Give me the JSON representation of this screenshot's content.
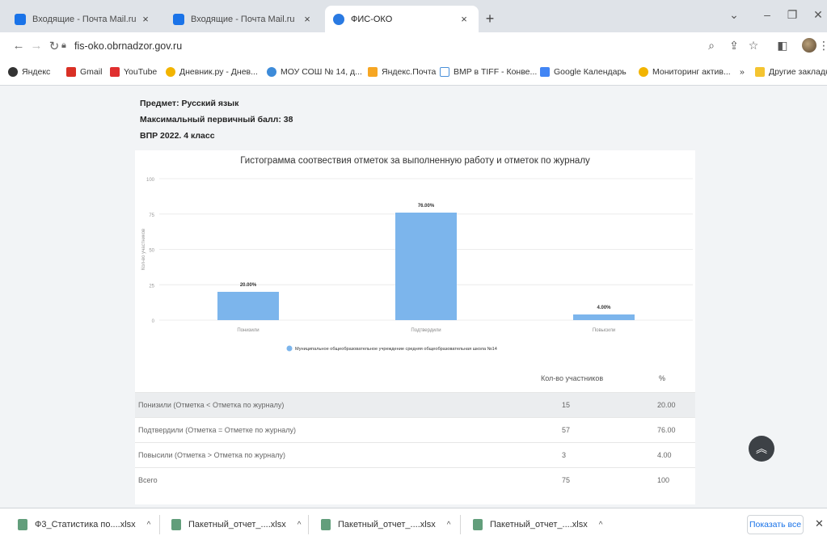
{
  "tabs": [
    {
      "title": "Входящие - Почта Mail.ru"
    },
    {
      "title": "Входящие - Почта Mail.ru"
    },
    {
      "title": "ФИС-ОКО"
    }
  ],
  "address": "fis-oko.obrnadzor.gov.ru",
  "bookmarks": [
    "Яндекс",
    "Gmail",
    "YouTube",
    "Дневник.ру - Днев...",
    "МОУ СОШ № 14, д...",
    "Яндекс.Почта",
    "BMP в TIFF - Конве...",
    "Google Календарь",
    "Мониторинг актив...",
    "»",
    "Другие закладки"
  ],
  "info": {
    "subject": "Предмет: Русский язык",
    "max_score": "Максимальный первичный балл: 38",
    "exam": "ВПР 2022. 4 класс"
  },
  "chart_data": {
    "type": "bar",
    "title": "Гистограмма соотвествия отметок за выполненную работу и отметок по журналу",
    "ylabel": "Кол-во участников",
    "categories": [
      "Понизили",
      "Подтвердили",
      "Повысили"
    ],
    "series": [
      {
        "name": "Муниципальное общеобразовательное учреждение средняя общеобразовательная школа №14",
        "values": [
          20,
          76,
          4
        ],
        "labels": [
          "20.00%",
          "76.00%",
          "4.00%"
        ],
        "color": "#7cb5ec"
      }
    ],
    "yticks": [
      "0",
      "25",
      "50",
      "75",
      "100"
    ],
    "ylim": [
      0,
      100
    ]
  },
  "table": {
    "headers": [
      "Кол-во участников",
      "%"
    ],
    "rows": [
      {
        "label": "Понизили (Отметка < Отметка по журналу)",
        "count": "15",
        "pct": "20.00"
      },
      {
        "label": "Подтвердили (Отметка = Отметке по журналу)",
        "count": "57",
        "pct": "76.00"
      },
      {
        "label": "Повысили (Отметка > Отметка по журналу)",
        "count": "3",
        "pct": "4.00"
      },
      {
        "label": "Всего",
        "count": "75",
        "pct": "100"
      }
    ]
  },
  "downloads": {
    "items": [
      "Ф3_Статистика по....xlsx",
      "Пакетный_отчет_....xlsx",
      "Пакетный_отчет_....xlsx",
      "Пакетный_отчет_....xlsx"
    ],
    "show_all": "Показать все"
  }
}
